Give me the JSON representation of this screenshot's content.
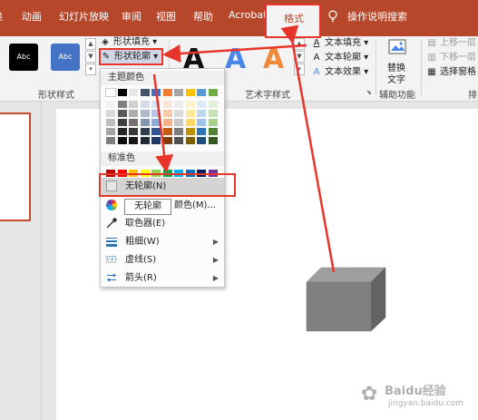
{
  "tabs": {
    "items": [
      "动画",
      "幻灯片放映",
      "审阅",
      "视图",
      "帮助",
      "Acrobat",
      "格式"
    ],
    "active": "格式"
  },
  "tell_me": "操作说明搜索",
  "ribbon": {
    "shape_styles": {
      "presets": [
        {
          "label": "Abc",
          "color": "#000000"
        },
        {
          "label": "Abc",
          "color": "#4472c4"
        }
      ],
      "fill_label": "形状填充",
      "outline_label": "形状轮廓",
      "group_label": "形状样式"
    },
    "wordart": {
      "letters": [
        {
          "text": "A",
          "color": "#111111"
        },
        {
          "text": "A",
          "color": "#4a86e8"
        },
        {
          "text": "A",
          "color": "#f08a3a"
        }
      ],
      "text_fill": "文本填充",
      "text_outline": "文本轮廓",
      "text_effect": "文本效果",
      "group_label": "艺术字样式"
    },
    "accessibility": {
      "alt_text_line1": "替换",
      "alt_text_line2": "文字",
      "group_label": "辅助功能"
    },
    "arrange": {
      "bring_forward": "上移一层",
      "send_backward": "下移一层",
      "selection_pane": "选择窗格",
      "group_label": "排"
    }
  },
  "menu": {
    "theme_colors_label": "主题颜色",
    "theme_top_row": [
      "#ffffff",
      "#000000",
      "#e7e6e6",
      "#44546a",
      "#4472c4",
      "#ed7d31",
      "#a5a5a5",
      "#ffc000",
      "#5b9bd5",
      "#70ad47"
    ],
    "theme_shades": [
      [
        "#f2f2f2",
        "#7f7f7f",
        "#d0cece",
        "#d6dce5",
        "#dae3f3",
        "#fbe5d6",
        "#ededed",
        "#fff2cc",
        "#deebf7",
        "#e2f0d9"
      ],
      [
        "#d9d9d9",
        "#595959",
        "#aeabab",
        "#adb9ca",
        "#b4c7e7",
        "#f8cbad",
        "#dbdbdb",
        "#ffe699",
        "#bdd7ee",
        "#c5e0b4"
      ],
      [
        "#bfbfbf",
        "#404040",
        "#757171",
        "#8497b0",
        "#8faadc",
        "#f4b183",
        "#c9c9c9",
        "#ffd966",
        "#9dc3e6",
        "#a9d18e"
      ],
      [
        "#a6a6a6",
        "#262626",
        "#3a3838",
        "#333f50",
        "#2f5597",
        "#c55a11",
        "#7b7b7b",
        "#bf9000",
        "#2e75b6",
        "#548235"
      ],
      [
        "#7f7f7f",
        "#0d0d0d",
        "#171616",
        "#222a35",
        "#203864",
        "#843c0c",
        "#525252",
        "#7f6000",
        "#1f4e79",
        "#385723"
      ]
    ],
    "standard_colors_label": "标准色",
    "standard_colors": [
      "#c00000",
      "#ff0000",
      "#ffc000",
      "#ffff00",
      "#92d050",
      "#00b050",
      "#00b0f0",
      "#0070c0",
      "#002060",
      "#7030a0"
    ],
    "no_outline": "无轮廓(N)",
    "more_colors_suffix": "颜色(M)...",
    "eyedropper": "取色器(E)",
    "weight": "粗细(W)",
    "dashes": "虚线(S)",
    "arrows": "箭头(R)"
  },
  "tooltip": "无轮廓",
  "watermark": {
    "main": "Baidu经验",
    "sub": "jingyan.baidu.com"
  }
}
